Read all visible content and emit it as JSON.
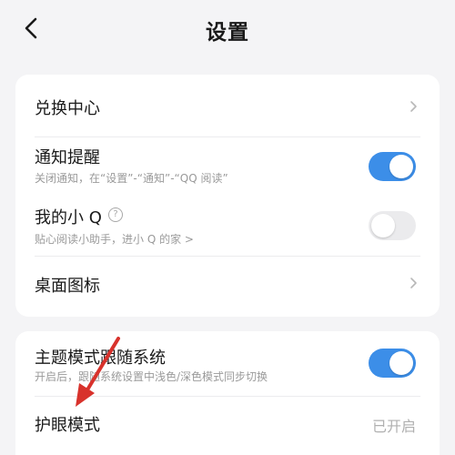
{
  "header": {
    "title": "设置",
    "back_icon": "chevron-left-icon"
  },
  "group1": {
    "items": [
      {
        "title": "兑换中心",
        "control": "chevron-right-icon"
      },
      {
        "title": "通知提醒",
        "subtitle": "关闭通知，在“设置”-“通知”-“QQ 阅读”",
        "toggle": "on"
      },
      {
        "title": "我的小 Q",
        "help_icon": "question-circle-icon",
        "help_glyph": "?",
        "subtitle": "贴心阅读小助手，进小 Q 的家 >",
        "toggle": "off"
      },
      {
        "title": "桌面图标",
        "control": "chevron-right-icon"
      }
    ]
  },
  "group2": {
    "items": [
      {
        "title": "主题模式跟随系统",
        "subtitle": "开启后，跟随系统设置中浅色/深色模式同步切换",
        "toggle": "on"
      },
      {
        "title": "护眼模式",
        "value": "已开启"
      }
    ]
  },
  "annotation": {
    "arrow_icon": "red-arrow-icon",
    "arrow_color": "#d8322c"
  },
  "colors": {
    "accent": "#3c8ee8",
    "toggle_off": "#ebebed",
    "background": "#f4f4f6"
  }
}
